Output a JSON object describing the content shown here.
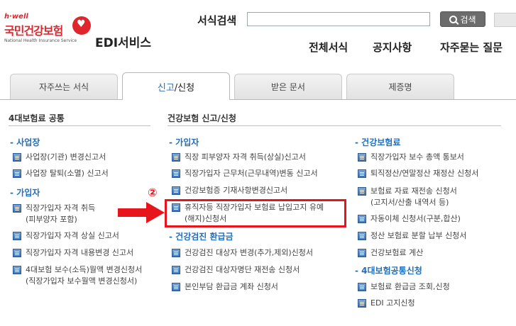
{
  "logo": {
    "tagline": "h·well",
    "name": "국민건강보험",
    "name_en": "National Health Insurance Service"
  },
  "service_title": "EDI서비스",
  "search": {
    "label": "서식검색",
    "value": "",
    "button": "검색"
  },
  "topnav": [
    "전체서식",
    "공지사항",
    "자주묻는 질문"
  ],
  "tabs": [
    {
      "label": "자주쓰는 서식"
    },
    {
      "label_part1": "신고",
      "label_part2": "/신청"
    },
    {
      "label": "받은 문서"
    },
    {
      "label": "제증명"
    }
  ],
  "columns": {
    "left_head": "4대보험료 공통",
    "right_head": "건강보험 신고/신청"
  },
  "col1": {
    "sections": [
      {
        "title": "- 사업장",
        "items": [
          "사업장(기관) 변경신고서",
          "사업장 탈퇴(소멸) 신고서"
        ]
      },
      {
        "title": "- 가입자",
        "items": [
          "직장가입자 자격 취득",
          "(피부양자 포함)",
          "직장가입자 자격 상실 신고서",
          "직장가입자 자격 내용변경 신고서",
          "4대보험 보수(소득)월액 변경신청서",
          "(직장가입자 보수월액 변경신청서)"
        ]
      }
    ]
  },
  "col2": {
    "sections": [
      {
        "title": "- 가입자",
        "items": [
          "직장 피부양자 자격 취득(상실)신고서",
          "직장가입자 근무처(근무내역)변동 신고서",
          "건강보험증 기재사항변경신고서",
          "휴직자등 직장가입자 보험료 납입고지 유예",
          "(해지)신청서"
        ]
      },
      {
        "title": "- 건강검진 환급금",
        "items": [
          "건강검진 대상자 변경(추가,제외)신청서",
          "건강검진 대상자명단 재전송 신청서",
          "본인부담 환급금 계좌 신청서"
        ]
      }
    ]
  },
  "col3": {
    "sections": [
      {
        "title": "- 건강보험료",
        "items": [
          "직장가입자 보수 총액 통보서",
          "퇴직정산/연말정산 재정산 신청서",
          "보험료 자료 재전송 신청서",
          "(고지서/산출 내역서 등)",
          "자동이체 신청서(구분,합산)",
          "정산 보험료 분할 납부 신청서",
          "건강보험료 계산"
        ]
      },
      {
        "title": "- 4대보험공통신청",
        "items": [
          "보험료 환급금 조회,신청",
          "EDI 고지신청"
        ]
      }
    ]
  },
  "annotation": {
    "marker": "②"
  },
  "colors": {
    "accent_blue": "#1f6fbf",
    "highlight_red": "#e8141b",
    "brand_red": "#e0262d"
  }
}
